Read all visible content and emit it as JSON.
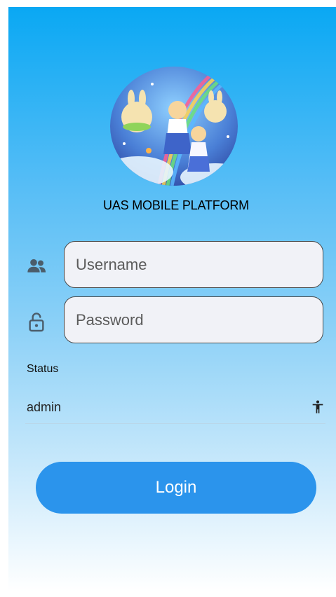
{
  "app": {
    "title": "UAS MOBILE PLATFORM"
  },
  "login": {
    "username_placeholder": "Username",
    "password_placeholder": "Password",
    "status_label": "Status",
    "status_value": "admin",
    "submit_label": "Login"
  },
  "icons": {
    "avatar": "anime-avatar-image",
    "username": "people-icon",
    "password": "lock-open-icon",
    "status": "person-standing-icon"
  },
  "colors": {
    "gradient_top": "#0aa8f3",
    "gradient_bottom": "#ffffff",
    "button": "#2b94ec",
    "button_text": "#ffffff",
    "field_bg": "#f1f2f7",
    "icon": "#4b5d6b"
  }
}
